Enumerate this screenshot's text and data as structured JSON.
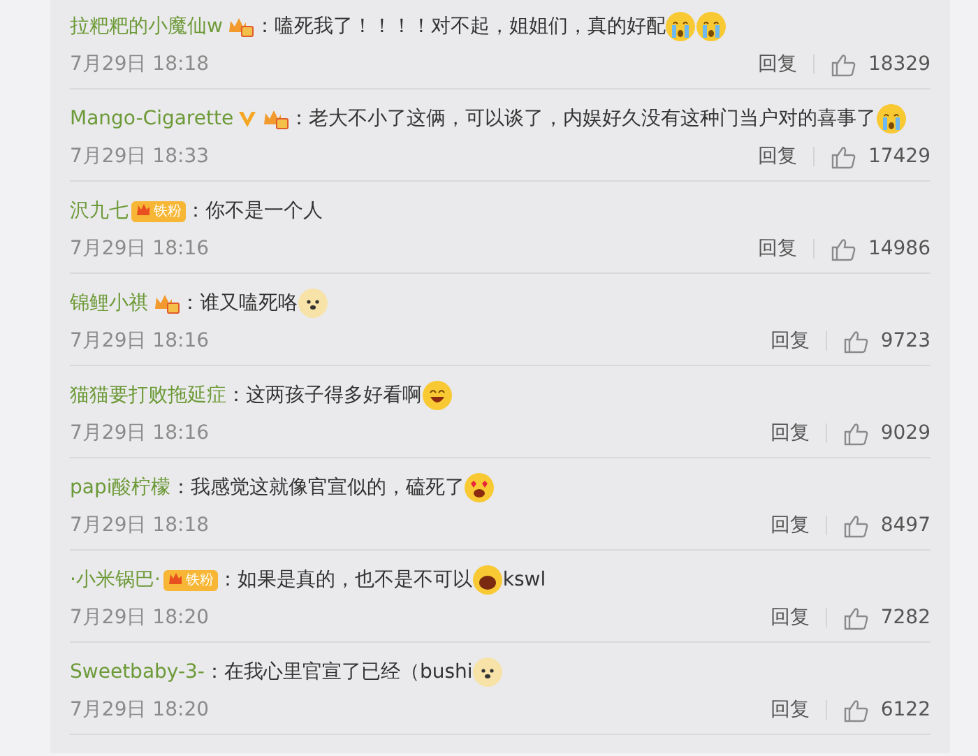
{
  "comments": [
    {
      "user": "拉粑粑的小魔仙w",
      "badges": [
        {
          "kind": "vip"
        }
      ],
      "content": [
        {
          "kind": "text",
          "text": "：嗑死我了！！！！对不起，姐姐们，真的好配"
        },
        {
          "kind": "cry"
        },
        {
          "kind": "cry"
        }
      ],
      "time": "7月29日 18:18",
      "reply": "回复",
      "likes": "18329"
    },
    {
      "user": "Mango-Cigarette",
      "badges": [
        {
          "kind": "verified"
        },
        {
          "kind": "vip"
        }
      ],
      "content": [
        {
          "kind": "text",
          "text": "：老大不小了这俩，可以谈了，内娱好久没有这种门当户对的喜事了"
        },
        {
          "kind": "cry"
        }
      ],
      "time": "7月29日 18:33",
      "reply": "回复",
      "likes": "17429"
    },
    {
      "user": "沢九七",
      "badges": [
        {
          "kind": "fan",
          "text": "铁粉"
        }
      ],
      "content": [
        {
          "kind": "text",
          "text": "：你不是一个人"
        }
      ],
      "time": "7月29日 18:16",
      "reply": "回复",
      "likes": "14986"
    },
    {
      "user": "锦鲤小祺",
      "badges": [
        {
          "kind": "vip"
        }
      ],
      "content": [
        {
          "kind": "text",
          "text": "：谁又嗑死咯"
        },
        {
          "kind": "dog"
        }
      ],
      "time": "7月29日 18:16",
      "reply": "回复",
      "likes": "9723"
    },
    {
      "user": "猫猫要打败拖延症",
      "content": [
        {
          "kind": "text",
          "text": "：这两孩子得多好看啊"
        },
        {
          "kind": "grin"
        }
      ],
      "time": "7月29日 18:16",
      "reply": "回复",
      "likes": "9029"
    },
    {
      "user": "papi酸柠檬",
      "content": [
        {
          "kind": "text",
          "text": "：我感觉这就像官宣似的，磕死了"
        },
        {
          "kind": "love"
        }
      ],
      "time": "7月29日 18:18",
      "reply": "回复",
      "likes": "8497"
    },
    {
      "user": "·小米锅巴·",
      "badges": [
        {
          "kind": "fan",
          "text": "铁粉"
        }
      ],
      "content": [
        {
          "kind": "text",
          "text": "：如果是真的，也不是不可以"
        },
        {
          "kind": "shout"
        },
        {
          "kind": "text",
          "text": "kswl"
        }
      ],
      "time": "7月29日 18:20",
      "reply": "回复",
      "likes": "7282"
    },
    {
      "user": "Sweetbaby-3-",
      "content": [
        {
          "kind": "text",
          "text": "：在我心里官宣了已经（bushi"
        },
        {
          "kind": "dog"
        }
      ],
      "time": "7月29日 18:20",
      "reply": "回复",
      "likes": "6122"
    }
  ]
}
